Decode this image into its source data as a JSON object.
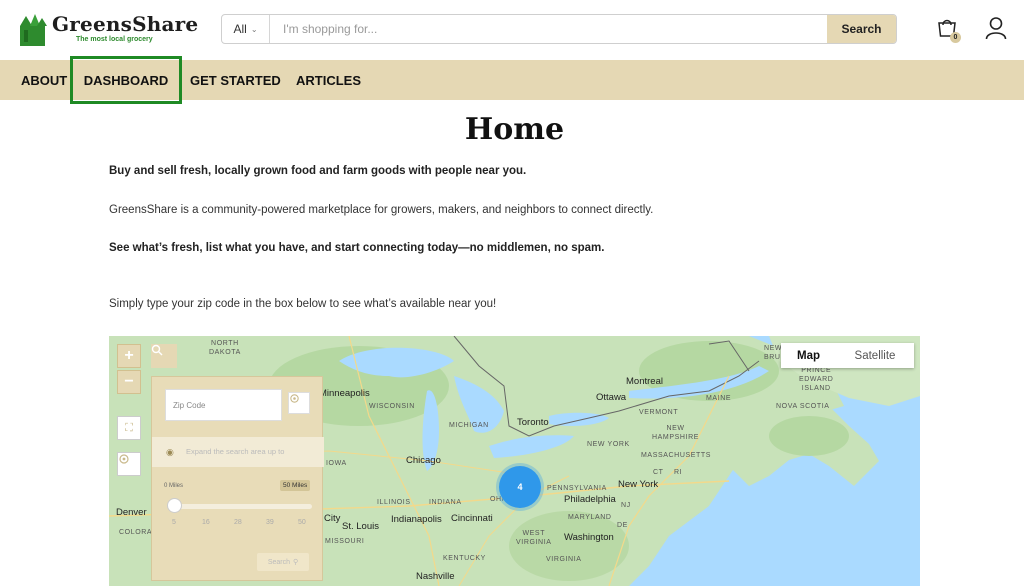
{
  "brand": {
    "name": "GreensShare",
    "tagline": "The most local grocery"
  },
  "search": {
    "category": "All",
    "placeholder": "I'm shopping for...",
    "button_label": "Search"
  },
  "cart": {
    "count": "0"
  },
  "nav": {
    "items": [
      {
        "label": "ABOUT"
      },
      {
        "label": "DASHBOARD"
      },
      {
        "label": "GET STARTED"
      },
      {
        "label": "ARTICLES"
      }
    ]
  },
  "page": {
    "title": "Home",
    "paragraphs": [
      "Buy and sell fresh, locally grown food and farm goods with people near you.",
      "GreensShare is a community-powered marketplace for growers, makers, and neighbors to connect directly.",
      "See what’s fresh, list what you have, and start connecting today—no middlemen, no spam.",
      "Simply type your zip code in the box below to see what’s available near you!"
    ]
  },
  "map": {
    "zoom_in": "+",
    "zoom_out": "−",
    "type_map": "Map",
    "type_satellite": "Satellite",
    "cluster_count": "4",
    "panel": {
      "zip_placeholder": "Zip Code",
      "expand_label": "Expand the search area up to",
      "range_min": "0 Miles",
      "range_max": "50 Miles",
      "ticks": [
        "5",
        "16",
        "28",
        "39",
        "50"
      ],
      "search_label": "Search"
    },
    "labels": {
      "north_dakota": "NORTH\nDAKOTA",
      "minneapolis": "Minneapolis",
      "wisconsin": "WISCONSIN",
      "michigan": "MICHIGAN",
      "toronto": "Toronto",
      "ottawa": "Ottawa",
      "montreal": "Montreal",
      "new_brunswick": "NEW\nBRUNSWICK",
      "prince_edward_island": "PRINCE\nEDWARD\nISLAND",
      "maine": "MAINE",
      "vermont": "VERMONT",
      "nova_scotia": "NOVA SCOTIA",
      "new_hampshire": "NEW\nHAMPSHIRE",
      "new_york_state": "NEW YORK",
      "massachusetts": "MASSACHUSETTS",
      "connecticut": "CT",
      "rhode_island": "RI",
      "chicago": "Chicago",
      "iowa": "IOWA",
      "illinois": "ILLINOIS",
      "indiana": "INDIANA",
      "ohio": "OHIO",
      "pennsylvania": "PENNSYLVANIA",
      "new_york_city": "New York",
      "philadelphia": "Philadelphia",
      "new_jersey": "NJ",
      "maryland": "MARYLAND",
      "delaware": "DE",
      "washington": "Washington",
      "west_virginia": "WEST\nVIRGINIA",
      "virginia": "VIRGINIA",
      "kentucky": "KENTUCKY",
      "nashville": "Nashville",
      "indianapolis": "Indianapolis",
      "cincinnati": "Cincinnati",
      "st_louis": "St. Louis",
      "city": "City",
      "missouri": "MISSOURI",
      "denver": "Denver",
      "colorado": "COLORA"
    }
  }
}
